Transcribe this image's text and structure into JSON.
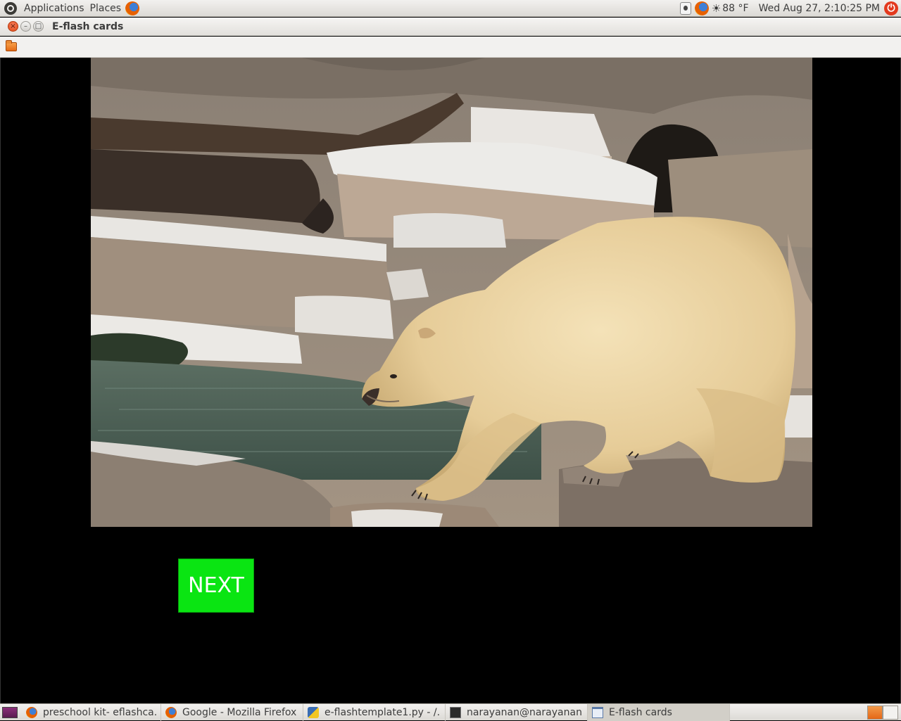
{
  "top_panel": {
    "menu_applications": "Applications",
    "menu_places": "Places",
    "weather": "88 °F",
    "clock": "Wed Aug 27,  2:10:25 PM"
  },
  "window": {
    "title": "E-flash cards"
  },
  "card": {
    "subject": "polar bear",
    "next_label": "NEXT",
    "next_color": "#0ae512"
  },
  "taskbar": {
    "tasks": [
      {
        "label": "preschool kit- eflashca...",
        "icon": "firefox-icon"
      },
      {
        "label": "Google - Mozilla Firefox",
        "icon": "firefox-icon"
      },
      {
        "label": "e-flashtemplate1.py - /...",
        "icon": "python-file-icon"
      },
      {
        "label": "narayanan@narayanan...",
        "icon": "terminal-icon"
      },
      {
        "label": "E-flash cards",
        "icon": "window-icon"
      }
    ]
  },
  "colors": {
    "background": "#000000",
    "panel": "#e6e4df",
    "close_button": "#df4a16"
  }
}
